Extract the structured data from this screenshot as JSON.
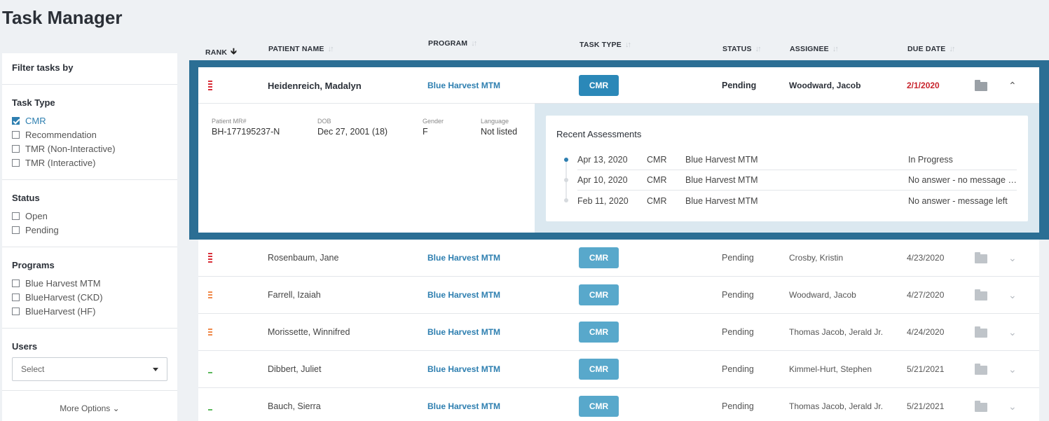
{
  "page": {
    "title": "Task Manager"
  },
  "sidebar": {
    "filter_label": "Filter tasks by",
    "task_type": {
      "label": "Task Type",
      "options": [
        {
          "label": "CMR",
          "checked": true
        },
        {
          "label": "Recommendation",
          "checked": false
        },
        {
          "label": "TMR (Non-Interactive)",
          "checked": false
        },
        {
          "label": "TMR (Interactive)",
          "checked": false
        }
      ]
    },
    "status": {
      "label": "Status",
      "options": [
        {
          "label": "Open",
          "checked": false
        },
        {
          "label": "Pending",
          "checked": false
        }
      ]
    },
    "programs": {
      "label": "Programs",
      "options": [
        {
          "label": "Blue Harvest MTM",
          "checked": false
        },
        {
          "label": "BlueHarvest (CKD)",
          "checked": false
        },
        {
          "label": "BlueHarvest (HF)",
          "checked": false
        }
      ]
    },
    "users": {
      "label": "Users",
      "select_value": "Select"
    },
    "more_options": "More Options"
  },
  "table": {
    "headers": {
      "rank": "RANK",
      "patient": "PATIENT NAME",
      "program": "PROGRAM",
      "task_type": "TASK TYPE",
      "status": "STATUS",
      "assignee": "ASSIGNEE",
      "due_date": "DUE DATE"
    },
    "expanded": {
      "rank_level": "high",
      "patient": "Heidenreich, Madalyn",
      "program": "Blue Harvest MTM",
      "task_type": "CMR",
      "status": "Pending",
      "assignee": "Woodward, Jacob",
      "due_date": "2/1/2020",
      "details": {
        "mr_label": "Patient MR#",
        "mr_value": "BH-177195237-N",
        "dob_label": "DOB",
        "dob_value": "Dec 27, 2001 (18)",
        "gender_label": "Gender",
        "gender_value": "F",
        "language_label": "Language",
        "language_value": "Not listed"
      },
      "assessments": {
        "title": "Recent Assessments",
        "items": [
          {
            "date": "Apr 13, 2020",
            "type": "CMR",
            "program": "Blue Harvest MTM",
            "status": "In Progress"
          },
          {
            "date": "Apr 10, 2020",
            "type": "CMR",
            "program": "Blue Harvest MTM",
            "status": "No answer - no message left"
          },
          {
            "date": "Feb 11, 2020",
            "type": "CMR",
            "program": "Blue Harvest MTM",
            "status": "No answer - message left"
          }
        ]
      }
    },
    "rows": [
      {
        "rank_level": "high",
        "patient": "Rosenbaum, Jane",
        "program": "Blue Harvest MTM",
        "task_type": "CMR",
        "status": "Pending",
        "assignee": "Crosby, Kristin",
        "due_date": "4/23/2020"
      },
      {
        "rank_level": "medium",
        "patient": "Farrell, Izaiah",
        "program": "Blue Harvest MTM",
        "task_type": "CMR",
        "status": "Pending",
        "assignee": "Woodward, Jacob",
        "due_date": "4/27/2020"
      },
      {
        "rank_level": "medium",
        "patient": "Morissette, Winnifred",
        "program": "Blue Harvest MTM",
        "task_type": "CMR",
        "status": "Pending",
        "assignee": "Thomas Jacob, Jerald Jr.",
        "due_date": "4/24/2020"
      },
      {
        "rank_level": "low",
        "patient": "Dibbert, Juliet",
        "program": "Blue Harvest MTM",
        "task_type": "CMR",
        "status": "Pending",
        "assignee": "Kimmel-Hurt, Stephen",
        "due_date": "5/21/2021"
      },
      {
        "rank_level": "low",
        "patient": "Bauch, Sierra",
        "program": "Blue Harvest MTM",
        "task_type": "CMR",
        "status": "Pending",
        "assignee": "Thomas Jacob, Jerald Jr.",
        "due_date": "5/21/2021"
      }
    ]
  },
  "colors": {
    "accent": "#2e7fb0",
    "expanded_border": "#2b6e94",
    "badge": "#58a8cb",
    "overdue": "#c8242c"
  }
}
